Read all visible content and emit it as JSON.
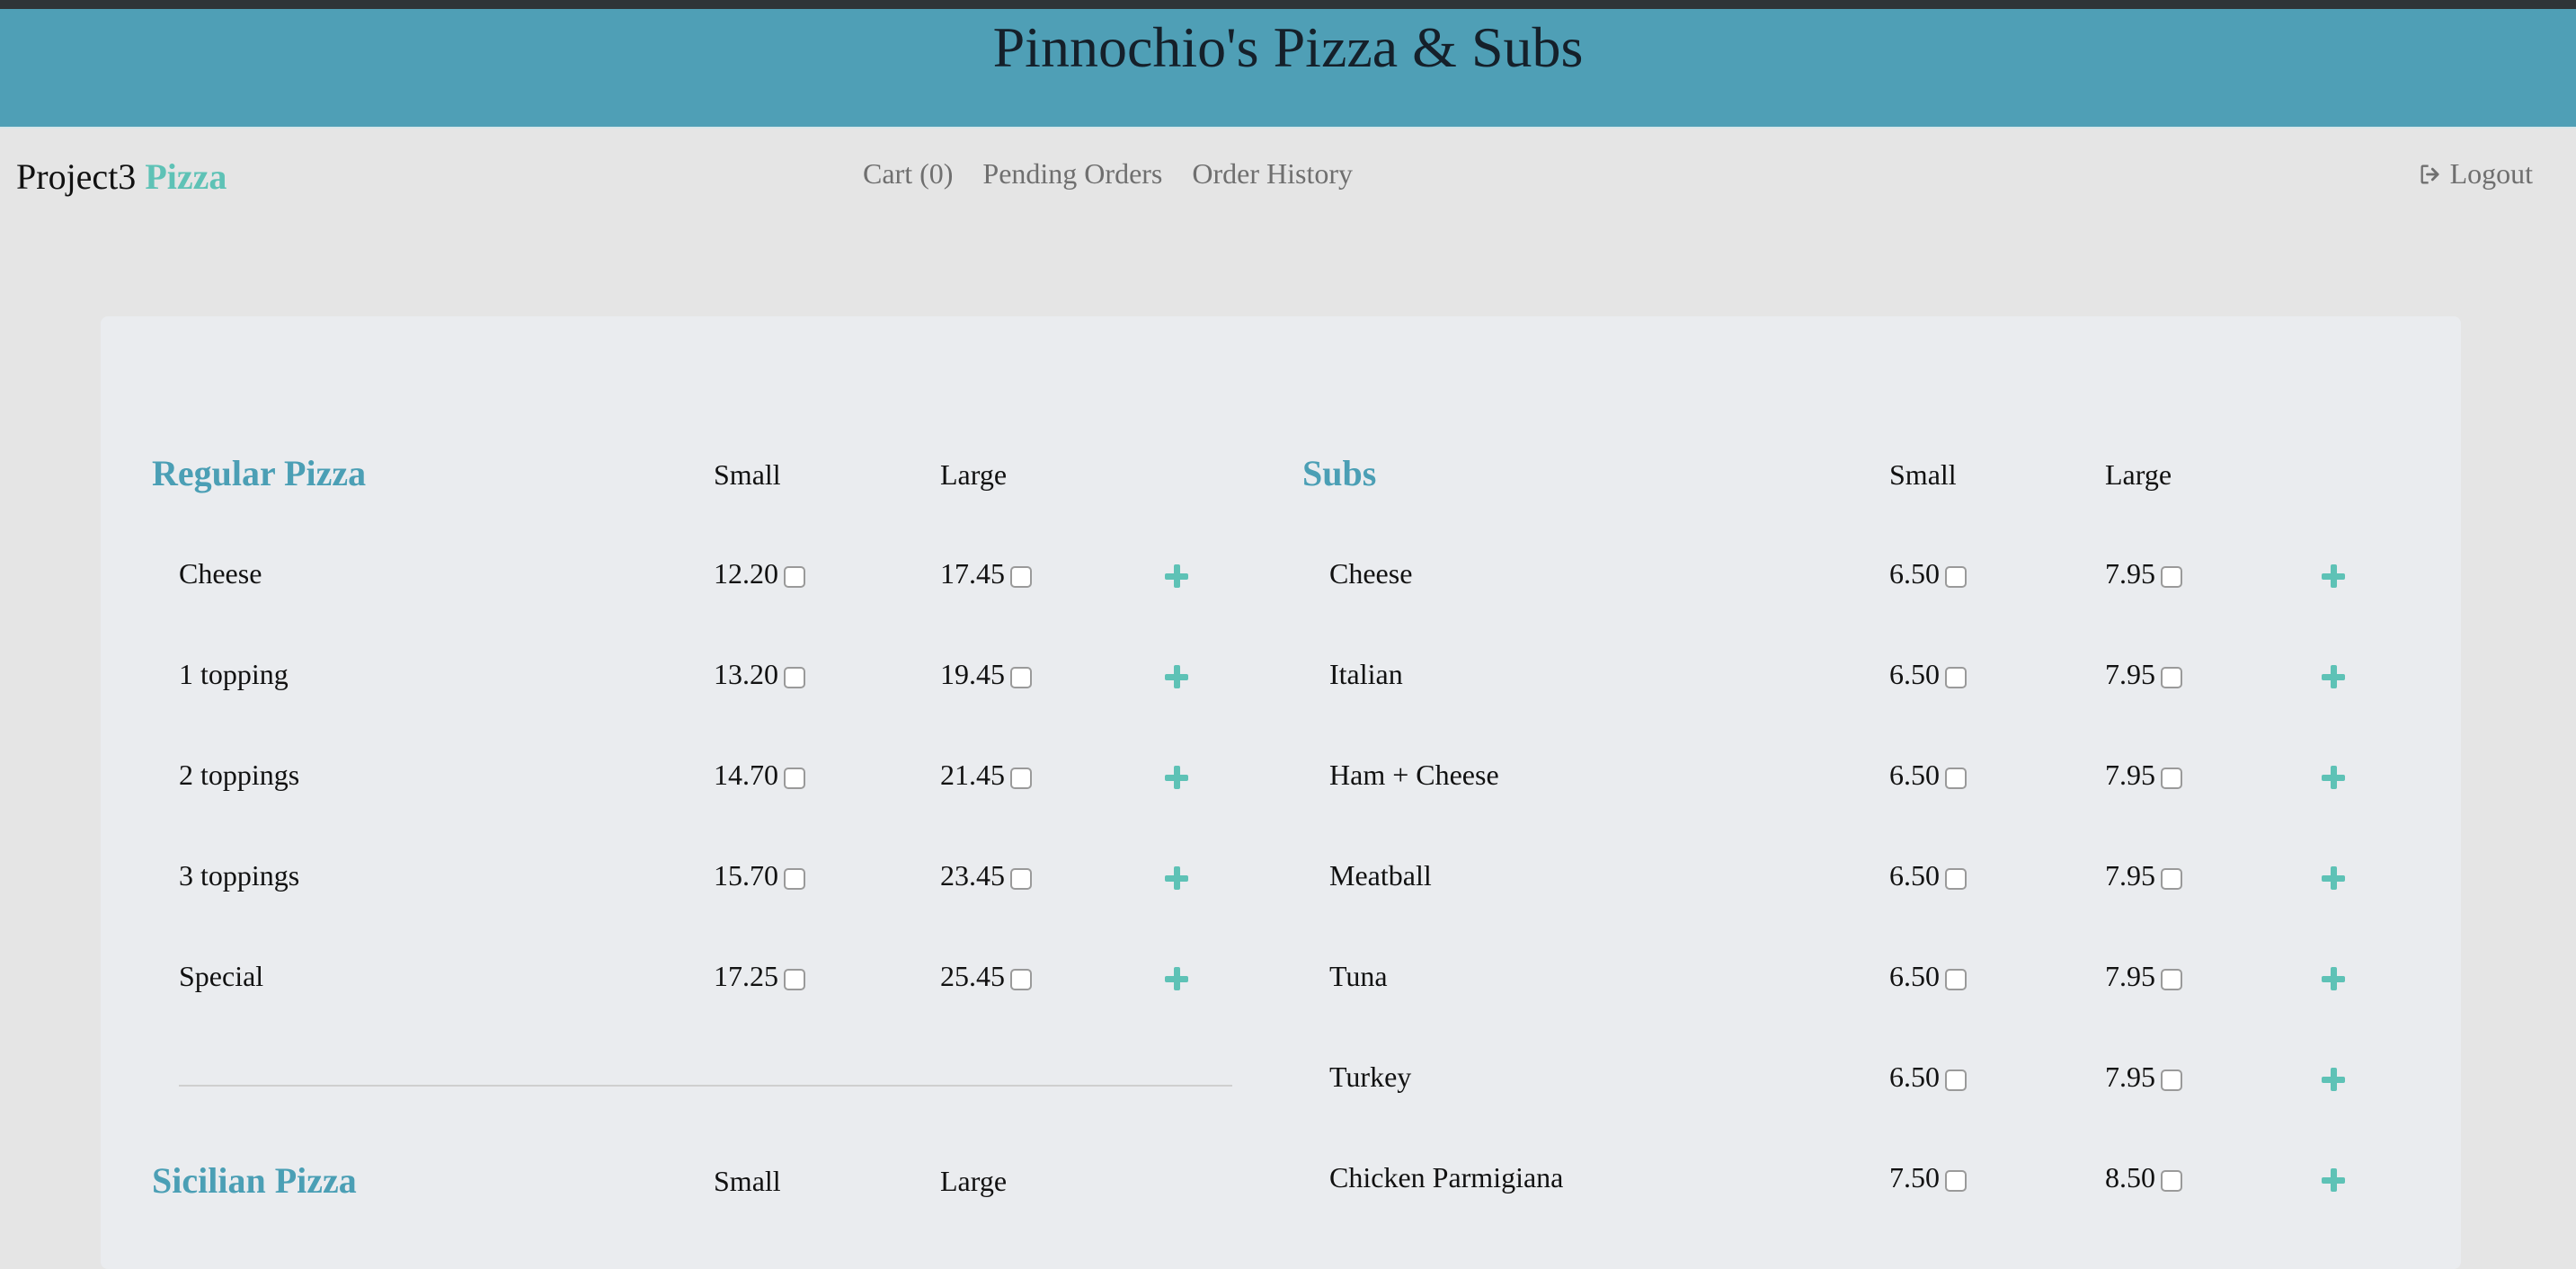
{
  "header": {
    "title": "Pinnochio's Pizza & Subs"
  },
  "nav": {
    "brand_main": "Project3",
    "brand_accent": "Pizza",
    "cart": "Cart (0)",
    "pending": "Pending Orders",
    "history": "Order History",
    "logout": "Logout"
  },
  "regular": {
    "title": "Regular Pizza",
    "small": "Small",
    "large": "Large",
    "items": [
      {
        "name": "Cheese",
        "small": "12.20",
        "large": "17.45"
      },
      {
        "name": "1 topping",
        "small": "13.20",
        "large": "19.45"
      },
      {
        "name": "2 toppings",
        "small": "14.70",
        "large": "21.45"
      },
      {
        "name": "3 toppings",
        "small": "15.70",
        "large": "23.45"
      },
      {
        "name": "Special",
        "small": "17.25",
        "large": "25.45"
      }
    ]
  },
  "sicilian": {
    "title": "Sicilian Pizza",
    "small": "Small",
    "large": "Large"
  },
  "subs": {
    "title": "Subs",
    "small": "Small",
    "large": "Large",
    "items": [
      {
        "name": "Cheese",
        "small": "6.50",
        "large": "7.95"
      },
      {
        "name": "Italian",
        "small": "6.50",
        "large": "7.95"
      },
      {
        "name": "Ham + Cheese",
        "small": "6.50",
        "large": "7.95"
      },
      {
        "name": "Meatball",
        "small": "6.50",
        "large": "7.95"
      },
      {
        "name": "Tuna",
        "small": "6.50",
        "large": "7.95"
      },
      {
        "name": "Turkey",
        "small": "6.50",
        "large": "7.95"
      },
      {
        "name": "Chicken Parmigiana",
        "small": "7.50",
        "large": "8.50"
      }
    ]
  },
  "colors": {
    "banner": "#4f9fb6",
    "accent": "#5ec2b6",
    "section_title": "#4b9fb5"
  }
}
